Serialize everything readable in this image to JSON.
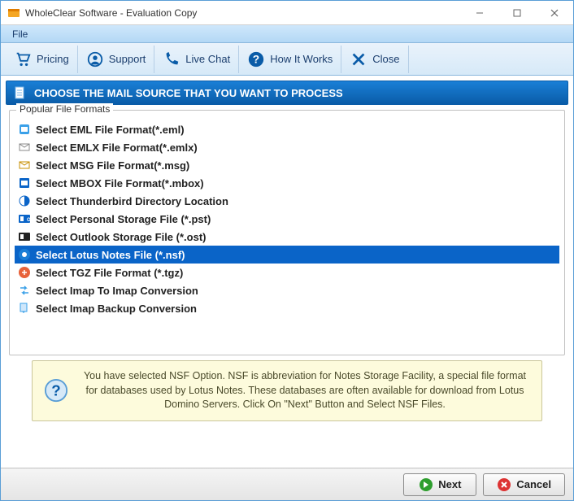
{
  "window": {
    "title": "WholeClear Software - Evaluation Copy"
  },
  "menubar": {
    "file_label": "File"
  },
  "toolbar": {
    "pricing_label": "Pricing",
    "support_label": "Support",
    "livechat_label": "Live Chat",
    "howitworks_label": "How It Works",
    "close_label": "Close"
  },
  "banner": {
    "text": "CHOOSE THE MAIL SOURCE THAT YOU WANT TO PROCESS"
  },
  "formats": {
    "legend": "Popular File Formats",
    "items": [
      {
        "label": "Select EML File Format(*.eml)"
      },
      {
        "label": "Select EMLX File Format(*.emlx)"
      },
      {
        "label": "Select MSG File Format(*.msg)"
      },
      {
        "label": "Select MBOX File Format(*.mbox)"
      },
      {
        "label": "Select Thunderbird Directory Location"
      },
      {
        "label": "Select Personal Storage File (*.pst)"
      },
      {
        "label": "Select Outlook Storage File (*.ost)"
      },
      {
        "label": "Select Lotus Notes File (*.nsf)"
      },
      {
        "label": "Select TGZ File Format (*.tgz)"
      },
      {
        "label": "Select Imap To Imap Conversion"
      },
      {
        "label": "Select Imap Backup Conversion"
      }
    ],
    "selected_index": 7
  },
  "info": {
    "text": "You have selected NSF Option. NSF is abbreviation for Notes Storage Facility, a special file format for databases used by Lotus Notes. These databases are often available for download from Lotus Domino Servers. Click On \"Next\" Button and Select NSF Files."
  },
  "footer": {
    "next_label": "Next",
    "cancel_label": "Cancel"
  },
  "colors": {
    "accent": "#0a64c8"
  }
}
